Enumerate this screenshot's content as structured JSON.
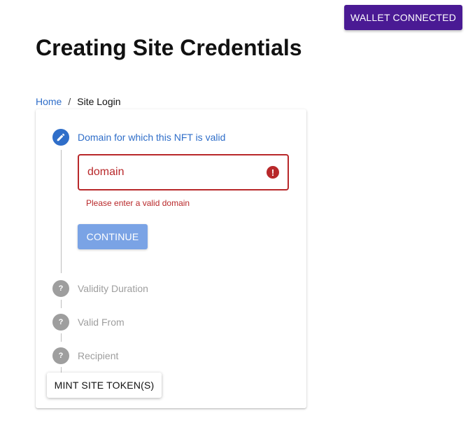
{
  "header": {
    "wallet_button_label": "WALLET CONNECTED",
    "page_title": "Creating Site Credentials"
  },
  "breadcrumb": {
    "home": "Home",
    "separator": "/",
    "current": "Site Login"
  },
  "stepper": {
    "steps": [
      {
        "label": "Domain for which this NFT is valid",
        "state": "active",
        "icon": "pencil-icon"
      },
      {
        "label": "Validity Duration",
        "state": "inactive",
        "icon": "question-icon",
        "marker": "?"
      },
      {
        "label": "Valid From",
        "state": "inactive",
        "icon": "question-icon",
        "marker": "?"
      },
      {
        "label": "Recipient",
        "state": "inactive",
        "icon": "question-icon",
        "marker": "?"
      }
    ],
    "domain_field": {
      "placeholder": "domain",
      "value": "",
      "error_marker": "!",
      "error_text": "Please enter a valid domain"
    },
    "continue_label": "CONTINUE"
  },
  "mint_button_label": "MINT SITE TOKEN(S)",
  "colors": {
    "wallet_button": "#4a1a94",
    "accent": "#2f6ec9",
    "error": "#b8282a",
    "continue_disabled": "#7aa3e5",
    "inactive": "#9e9e9e"
  }
}
